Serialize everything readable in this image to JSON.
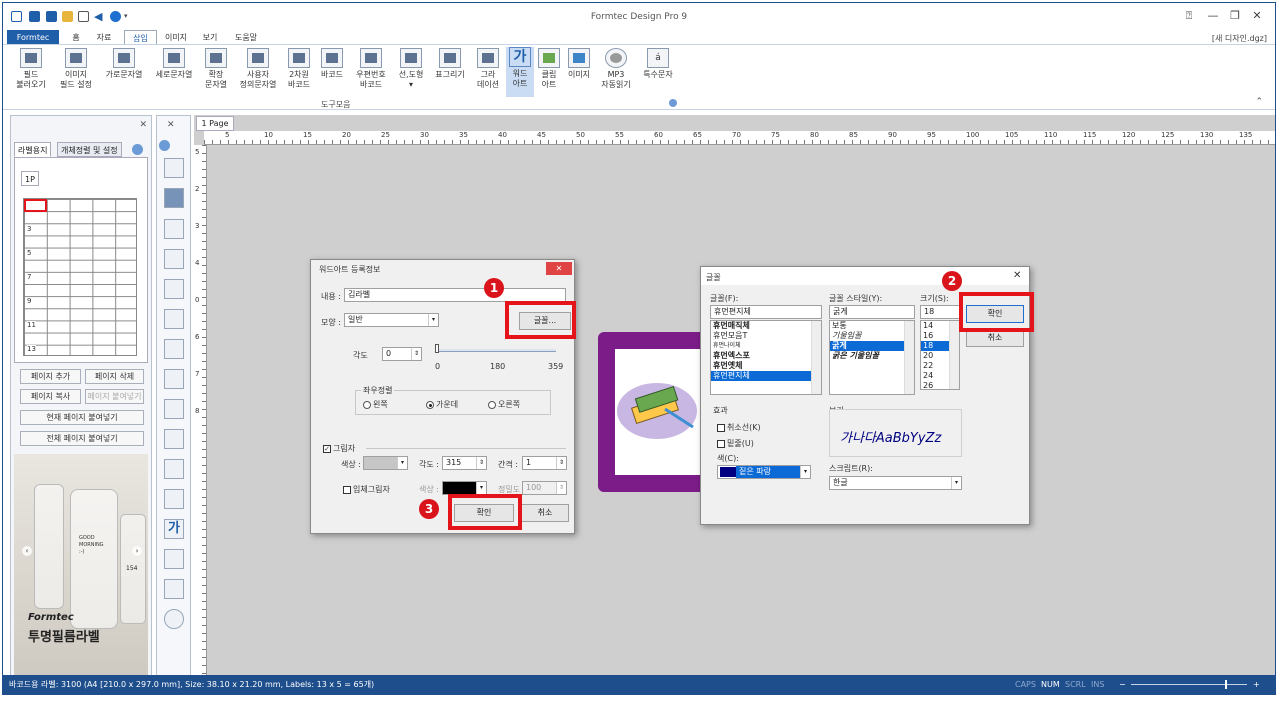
{
  "app": {
    "title": "Formtec Design Pro 9",
    "doc_name": "[새 디자인.dgz]"
  },
  "tabs": [
    "Formtec",
    "홈",
    "자료",
    "삽입",
    "이미지",
    "보기",
    "도움말"
  ],
  "ribbon": {
    "buttons": [
      {
        "l1": "필드",
        "l2": "불러오기"
      },
      {
        "l1": "이미지",
        "l2": "필드 설정"
      },
      {
        "l1": "가로문자열",
        "l2": ""
      },
      {
        "l1": "세로문자열",
        "l2": ""
      },
      {
        "l1": "확장",
        "l2": "문자열"
      },
      {
        "l1": "사용자",
        "l2": "정의문자열"
      },
      {
        "l1": "2차원",
        "l2": "바코드"
      },
      {
        "l1": "바코드",
        "l2": ""
      },
      {
        "l1": "우편번호",
        "l2": "바코드"
      },
      {
        "l1": "선,도형",
        "l2": "▾"
      },
      {
        "l1": "표그리기",
        "l2": ""
      },
      {
        "l1": "그라",
        "l2": "데이션"
      },
      {
        "l1": "워드",
        "l2": "아트"
      },
      {
        "l1": "클립",
        "l2": "아트"
      },
      {
        "l1": "이미지",
        "l2": ""
      },
      {
        "l1": "MP3",
        "l2": "자동읽기"
      },
      {
        "l1": "특수문자",
        "l2": ""
      }
    ],
    "group_label": "도구모음"
  },
  "left_panel": {
    "tabs": [
      "라벨용지",
      "개체정렬 및 설정"
    ],
    "page_tab": "1P",
    "row_numbers": [
      "1",
      "3",
      "5",
      "7",
      "9",
      "11",
      "13"
    ],
    "buttons": {
      "add_page": "페이지 추가",
      "delete_page": "페이지 삭제",
      "copy_page": "페이지 복사",
      "paste_page": "페이지 붙여넣기",
      "paste_current": "현재 페이지 붙여넣기",
      "paste_all": "전체 페이지 붙여넣기"
    },
    "ad": {
      "brand": "Formtec",
      "title": "투명필름라벨",
      "bottle_text1": "GOOD",
      "bottle_text2": "MORNING",
      "bottle_text3": ":-)",
      "bottle_num": "154"
    }
  },
  "page_tab": "1 Page",
  "ruler": {
    "h": [
      "5",
      "10",
      "15",
      "20",
      "25",
      "30",
      "35",
      "40",
      "45",
      "50",
      "55",
      "60",
      "65",
      "70",
      "75",
      "80",
      "85",
      "90",
      "95",
      "100",
      "105",
      "110",
      "115",
      "120",
      "125",
      "130",
      "135"
    ],
    "v": [
      "5",
      "2",
      "3",
      "4",
      "0",
      "6",
      "7",
      "8"
    ]
  },
  "wordart_dialog": {
    "title": "워드아트 등록정보",
    "content_label": "내용 :",
    "content_value": "김라벨",
    "font_button": "글꼴...",
    "shape_label": "모양 :",
    "shape_value": "일반",
    "angle_label": "각도",
    "angle_value": "0",
    "slider_min": "0",
    "slider_mid": "180",
    "slider_max": "359",
    "align_group": "좌우정렬",
    "align_left": "왼쪽",
    "align_center": "가운데",
    "align_right": "오른쪽",
    "shadow_label": "그림자",
    "shadow_color_label": "색상 :",
    "shadow_angle_label": "각도 :",
    "shadow_angle_value": "315",
    "shadow_gap_label": "간격 :",
    "shadow_gap_value": "1",
    "solid_shadow_label": "입체그림자",
    "solid_color_label": "색상 :",
    "solid_precision_label": "정밀도",
    "solid_precision_value": "100",
    "ok": "확인",
    "cancel": "취소"
  },
  "font_dialog": {
    "title": "글꼴",
    "font_label": "글꼴(F):",
    "font_value": "휴먼편지체",
    "fonts": [
      "휴먼매직체",
      "휴먼모음T",
      "휴먼나이체",
      "휴먼엑스포",
      "휴먼옛체",
      "휴먼편지체"
    ],
    "style_label": "글꼴 스타일(Y):",
    "style_value": "굵게",
    "styles": [
      "보통",
      "기울임꼴",
      "굵게",
      "굵은 기울임꼴"
    ],
    "size_label": "크기(S):",
    "size_value": "18",
    "sizes": [
      "14",
      "16",
      "18",
      "20",
      "22",
      "24",
      "26"
    ],
    "ok": "확인",
    "cancel": "취소",
    "effects_label": "효과",
    "strike_label": "취소선(K)",
    "underline_label": "밑줄(U)",
    "color_label": "색(C):",
    "color_value": "짙은 파랑",
    "preview_label": "보기",
    "preview_text": "가나다AaBbYyZz",
    "script_label": "스크립트(R):",
    "script_value": "한글"
  },
  "markers": [
    "1",
    "2",
    "3"
  ],
  "status": {
    "text": "바코드용 라벨: 3100 (A4 [210.0 x 297.0 mm], Size: 38.10 x 21.20 mm,  Labels: 13 x 5 = 65개)",
    "caps": "CAPS",
    "num": "NUM",
    "scrl": "SCRL",
    "ins": "INS",
    "zoom_minus": "−",
    "zoom_plus": "+"
  }
}
